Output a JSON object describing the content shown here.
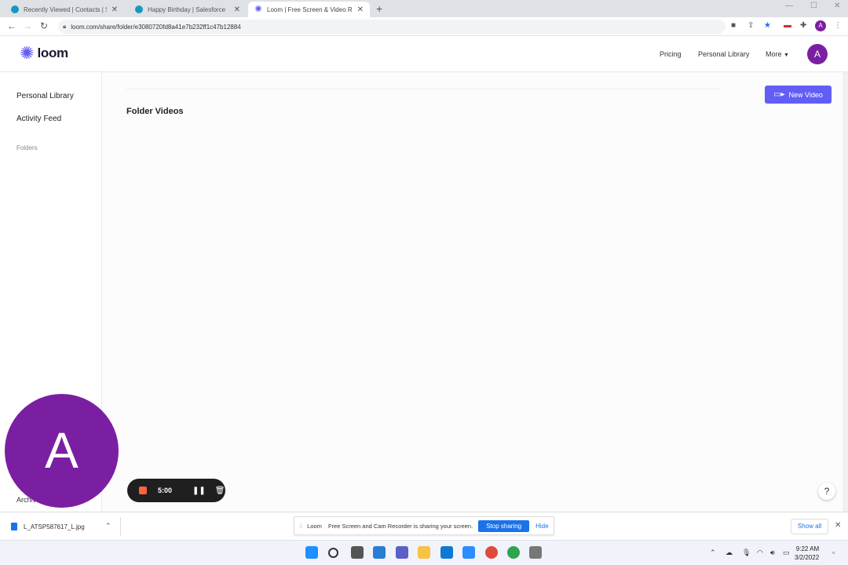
{
  "browser": {
    "tabs": [
      {
        "label": "Recently Viewed | Contacts | Sale"
      },
      {
        "label": "Happy Birthday | Salesforce"
      },
      {
        "label": "Loom | Free Screen & Video Reco"
      }
    ],
    "url": "loom.com/share/folder/e3080720fd8a41e7b232ff1c47b12884",
    "avatar_initial": "A"
  },
  "header": {
    "logo_text": "loom",
    "nav": {
      "pricing": "Pricing",
      "personal_library": "Personal Library",
      "more": "More"
    },
    "avatar_initial": "A"
  },
  "sidebar": {
    "personal_library": "Personal Library",
    "activity_feed": "Activity Feed",
    "folders_heading": "Folders",
    "archive": "Archive"
  },
  "main": {
    "folder_title": "Folder Videos",
    "new_video_label": "New Video",
    "help": "?"
  },
  "camera_bubble": {
    "initial": "A"
  },
  "recorder": {
    "timer": "5:00"
  },
  "download_shelf": {
    "file_name": "L_ATSP587617_L.jpg",
    "share_source": "Loom",
    "share_message": "Free Screen and Cam Recorder is sharing your screen.",
    "stop_sharing": "Stop sharing",
    "hide": "Hide",
    "show_all": "Show all"
  },
  "taskbar": {
    "time": "9:22 AM",
    "date": "3/2/2022"
  },
  "colors": {
    "loom_purple": "#625df5",
    "avatar_purple": "#7b1fa2",
    "record_red": "#ff623e",
    "chrome_blue": "#1a73e8"
  }
}
